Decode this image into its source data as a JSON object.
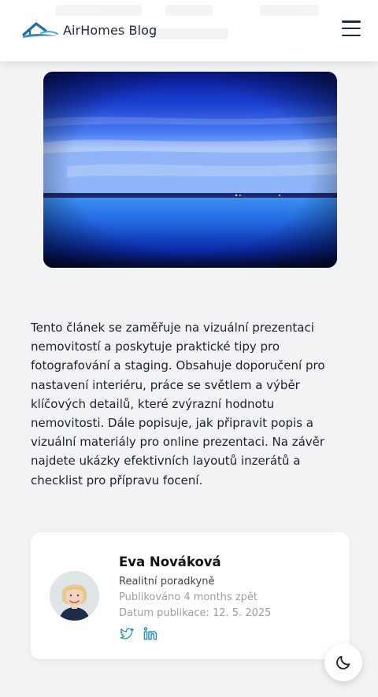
{
  "header": {
    "brand": "AirHomes Blog",
    "logo_icon": "house-roof-logo-icon",
    "menu_icon": "hamburger-menu-icon"
  },
  "hero_image": {
    "subject": "lake-at-dusk-photo"
  },
  "article": {
    "summary": "Tento článek se zaměřuje na vizuální prezentaci nemovitostí a poskytuje praktické tipy pro fotografování a staging. Obsahuje doporučení pro nastavení interiéru, práce se světlem a výběr klíčových detailů, které zvýrazní hodnotu nemovitosti. Dále popisuje, jak připravit popis a vizuální materiály pro online prezentaci. Na závěr najdete ukázky efektivních layoutů inzerátů a checklist pro přípravu focení."
  },
  "author": {
    "name": "Eva Nováková",
    "role": "Realitní poradkyně",
    "published_relative": "Publikováno 4 months zpět",
    "published_date": "Datum publikace: 12. 5. 2025",
    "socials": [
      "twitter-icon",
      "linkedin-icon"
    ]
  },
  "theme_toggle": {
    "icon": "moon-icon"
  },
  "colors": {
    "accent": "#2d8ecf",
    "brand": "#1b6fa8",
    "page_bg": "#f2f3f5"
  }
}
